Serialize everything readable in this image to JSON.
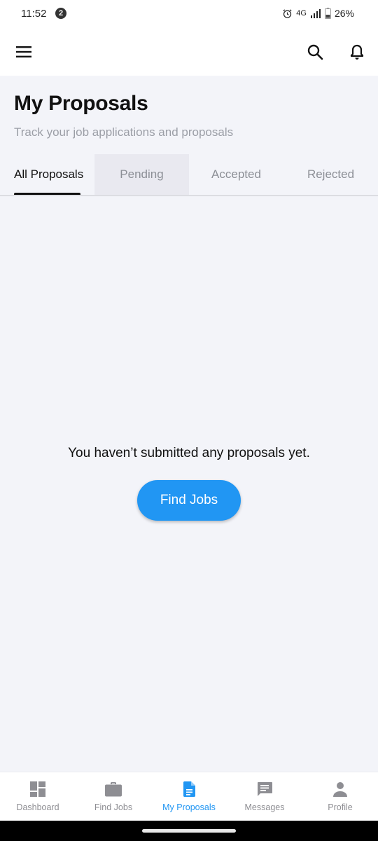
{
  "status_bar": {
    "time": "11:52",
    "notification_count": "2",
    "network": "4G",
    "battery": "26%"
  },
  "header": {
    "title": "My Proposals",
    "subtitle": "Track your job applications and proposals"
  },
  "tabs": [
    {
      "label": "All Proposals",
      "selected": true
    },
    {
      "label": "Pending",
      "selected": false
    },
    {
      "label": "Accepted",
      "selected": false
    },
    {
      "label": "Rejected",
      "selected": false
    }
  ],
  "empty_state": {
    "message": "You haven’t submitted any proposals yet.",
    "button_label": "Find Jobs"
  },
  "bottom_nav": {
    "items": [
      {
        "label": "Dashboard",
        "icon": "dashboard-icon"
      },
      {
        "label": "Find Jobs",
        "icon": "briefcase-icon"
      },
      {
        "label": "My Proposals",
        "icon": "document-icon",
        "active": true
      },
      {
        "label": "Messages",
        "icon": "message-icon"
      },
      {
        "label": "Profile",
        "icon": "person-icon"
      }
    ]
  },
  "colors": {
    "accent": "#2196f3",
    "background": "#f3f4f9",
    "muted_text": "#8e8e93"
  }
}
